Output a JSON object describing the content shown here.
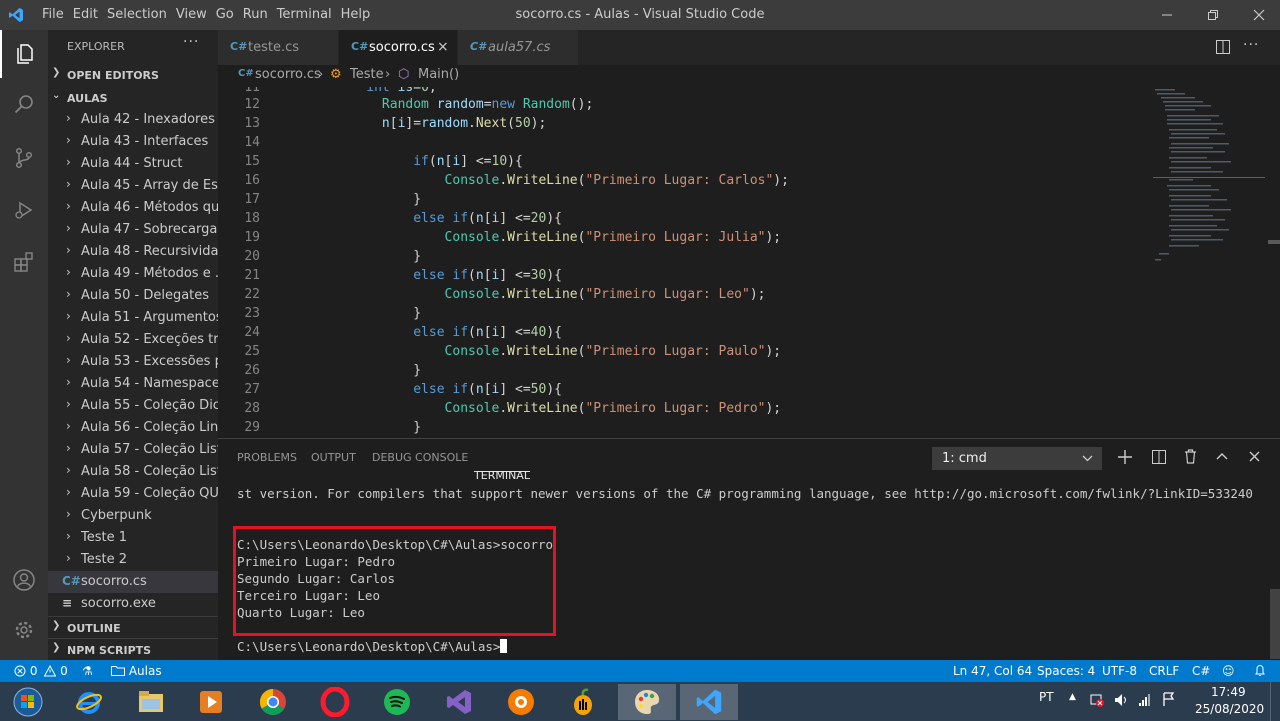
{
  "window": {
    "title": "socorro.cs - Aulas - Visual Studio Code"
  },
  "menu": [
    "File",
    "Edit",
    "Selection",
    "View",
    "Go",
    "Run",
    "Terminal",
    "Help"
  ],
  "sidebar": {
    "header": "EXPLORER",
    "more": "···",
    "open_editors": "OPEN EDITORS",
    "folder": "AULAS",
    "items": [
      "Aula 42 - Inexadores ...",
      "Aula 43 - Interfaces",
      "Aula 44 - Struct",
      "Aula 45 - Array de Est...",
      "Aula 46 - Métodos qu...",
      "Aula 47 - Sobrecarga ...",
      "Aula 48 - Recursividade",
      "Aula 49 - Métodos e ...",
      "Aula 50 - Delegates",
      "Aula 51 - Argumentos...",
      "Aula 52 - Exceções try...",
      "Aula 53 - Excessões p...",
      "Aula 54 - Namespaces",
      "Aula 55 - Coleção Dic...",
      "Aula 56 - Coleção Lin...",
      "Aula 57 - Coleção List...",
      "Aula 58 - Coleção List...",
      "Aula 59 - Coleção QU...",
      "Cyberpunk",
      "Teste 1",
      "Teste 2"
    ],
    "files": [
      "socorro.cs",
      "socorro.exe"
    ],
    "outline": "OUTLINE",
    "npm": "NPM SCRIPTS"
  },
  "tabs": [
    {
      "label": "teste.cs"
    },
    {
      "label": "socorro.cs"
    },
    {
      "label": "aula57.cs"
    }
  ],
  "breadcrumb": {
    "file": "socorro.cs",
    "cls": "Teste",
    "method": "Main()"
  },
  "editor": {
    "line_numbers": [
      "11",
      "12",
      "13",
      "14",
      "15",
      "16",
      "17",
      "18",
      "19",
      "20",
      "21",
      "22",
      "23",
      "24",
      "25",
      "26",
      "27",
      "28",
      "29"
    ]
  },
  "panel": {
    "tabs": [
      "PROBLEMS",
      "OUTPUT",
      "DEBUG CONSOLE",
      "TERMINAL"
    ],
    "terminal_select": "1: cmd",
    "lines": [
      "st version. For compilers that support newer versions of the C# programming language, see http://go.microsoft.com/fwlink/?LinkID=533240",
      "C:\\Users\\Leonardo\\Desktop\\C#\\Aulas>socorro",
      "Primeiro Lugar: Pedro",
      "Segundo Lugar: Carlos",
      "Terceiro Lugar: Leo",
      "Quarto Lugar: Leo",
      "C:\\Users\\Leonardo\\Desktop\\C#\\Aulas>"
    ]
  },
  "statusbar": {
    "errors": "0",
    "warnings": "0",
    "folder": "Aulas",
    "position": "Ln 47, Col 64",
    "spaces": "Spaces: 4",
    "encoding": "UTF-8",
    "eol": "CRLF",
    "language": "C#"
  },
  "taskbar": {
    "lang": "PT",
    "time": "17:49",
    "date": "25/08/2020"
  },
  "colors": {
    "accent": "#007acc",
    "highlight": "#e81123"
  }
}
